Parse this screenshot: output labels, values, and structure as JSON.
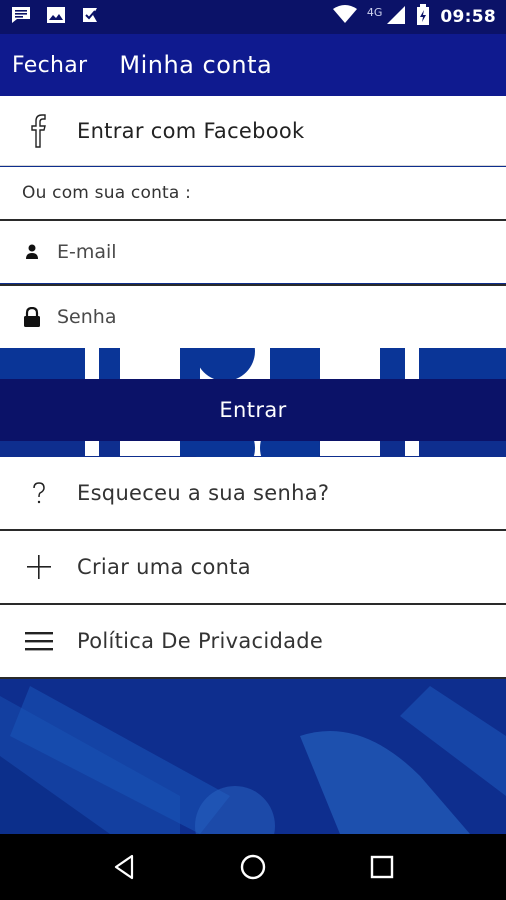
{
  "status_bar": {
    "time": "09:58",
    "network": "4G",
    "icons": [
      "message-icon",
      "image-icon",
      "checklist-icon",
      "wifi-icon",
      "signal-icon",
      "battery-icon"
    ]
  },
  "toolbar": {
    "close_label": "Fechar",
    "title": "Minha conta"
  },
  "facebook": {
    "label": "Entrar com Facebook",
    "icon": "facebook-icon"
  },
  "login": {
    "or_label": "Ou com sua conta :",
    "email_placeholder": "E-mail",
    "email_value": "",
    "password_placeholder": "Senha",
    "password_value": "",
    "submit_label": "Entrar"
  },
  "menu": {
    "items": [
      {
        "label": "Esqueceu a sua senha?",
        "icon": "question-icon"
      },
      {
        "label": "Criar uma conta",
        "icon": "plus-icon"
      },
      {
        "label": "Política De Privacidade",
        "icon": "menu-lines-icon"
      }
    ]
  },
  "navigation": {
    "buttons": [
      "back-icon",
      "home-icon",
      "recents-icon"
    ]
  },
  "colors": {
    "primary_dark": "#0b1268",
    "toolbar": "#0f1a8f",
    "background": "#0e2e8e"
  }
}
